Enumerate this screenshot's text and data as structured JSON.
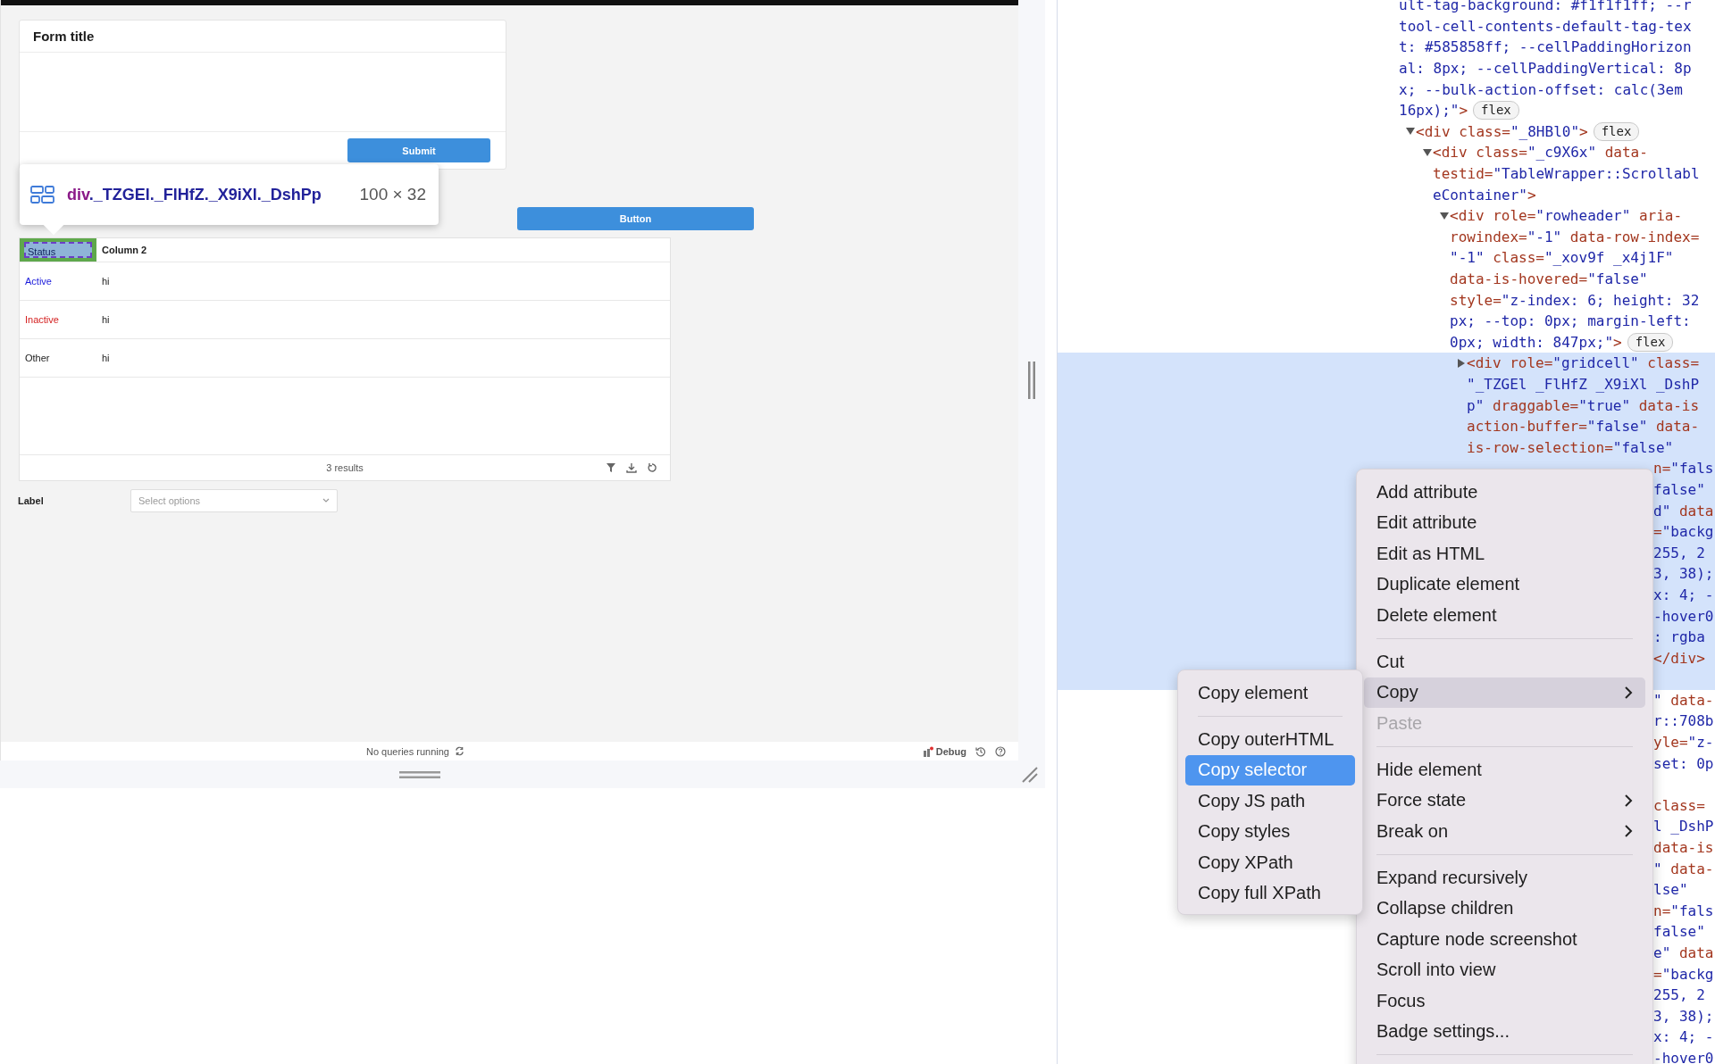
{
  "app": {
    "form": {
      "title": "Form title",
      "submit": "Submit"
    },
    "button": "Button",
    "table": {
      "columns": [
        {
          "label": "Status",
          "inspected": true
        },
        {
          "label": "Column 2",
          "inspected": false
        }
      ],
      "rows": [
        {
          "status": "Active",
          "color": "#1a1adb",
          "value": "hi"
        },
        {
          "status": "Inactive",
          "color": "#d42020",
          "value": "hi"
        },
        {
          "status": "Other",
          "value": "hi"
        }
      ],
      "footer": "3 results"
    },
    "field": {
      "label": "Label",
      "placeholder": "Select options"
    },
    "status_bar": {
      "message": "No queries running",
      "debug": "Debug"
    },
    "inspector_tooltip": {
      "tag": "div",
      "classes": "._TZGEl._FlHfZ._X9iXl._DshPp",
      "size": "100 × 32"
    }
  },
  "devtools": {
    "tree": {
      "continued": true,
      "selected": false,
      "badge": "flex",
      "lines": [
        "ult-tag-background: #f1f1f1ff; --r",
        "tool-cell-contents-default-tag-tex",
        "t: #585858ff; --cellPaddingHorizon",
        "al: 8px; --cellPaddingVertical: 8p",
        "x; --bulk-action-offset: calc(3em",
        "16px);\">"
      ],
      "children": [
        {
          "expanded": true,
          "selected": false,
          "badge": "flex",
          "lines": [
            "<div class=\"_8HBl0\">"
          ],
          "children": [
            {
              "expanded": true,
              "selected": false,
              "lines": [
                "<div class=\"_c9X6x\" data-",
                "testid=\"TableWrapper::Scrollabl",
                "eContainer\">"
              ],
              "children": [
                {
                  "expanded": true,
                  "selected": false,
                  "badge": "flex",
                  "lines": [
                    "<div role=\"rowheader\" aria-",
                    "rowindex=\"-1\" data-row-index=",
                    "\"-1\" class=\"_xov9f _x4j1F\"",
                    "data-is-hovered=\"false\"",
                    "style=\"z-index: 6; height: 32",
                    "px; --top: 0px; margin-left:",
                    "0px; width: 847px;\">"
                  ],
                  "children": [
                    {
                      "expanded": false,
                      "selected": true,
                      "lines": [
                        "<div role=\"gridcell\" class=",
                        "\"_TZGEl _FlHfZ _X9iXl _DshP",
                        "p\" draggable=\"true\" data-is",
                        "action-buffer=\"false\" data-",
                        "is-row-selection=\"false\""
                      ]
                    }
                  ]
                }
              ]
            }
          ]
        }
      ]
    },
    "fragments": [
      {
        "kind": "text",
        "text": "n=\"fals",
        "in_value": false,
        "selected": true
      },
      {
        "kind": "text",
        "text": "false\"",
        "in_value": true,
        "selected": true
      },
      {
        "kind": "text",
        "text": "d\" data",
        "in_value": true,
        "selected": true
      },
      {
        "kind": "text",
        "text": "=\"backg",
        "in_value": false,
        "selected": true
      },
      {
        "kind": "text",
        "text": "255, 2",
        "in_value": true,
        "selected": true
      },
      {
        "kind": "text",
        "text": "3, 38);",
        "in_value": true,
        "selected": true
      },
      {
        "kind": "text",
        "text": "x: 4; -",
        "in_value": true,
        "selected": true
      },
      {
        "kind": "text",
        "text": "-hover0",
        "in_value": true,
        "selected": true
      },
      {
        "kind": "text",
        "text": ": rgba",
        "in_value": true,
        "selected": true
      },
      {
        "kind": "text",
        "text": "</div>",
        "in_value": false,
        "selected": true
      },
      {
        "kind": "covered",
        "selected": true
      },
      {
        "kind": "text",
        "text": "\" data-",
        "in_value": true,
        "selected": false
      },
      {
        "kind": "text",
        "text": "r::708b",
        "in_value": true,
        "selected": false
      },
      {
        "kind": "text",
        "text": "yle=\"z-",
        "in_value": false,
        "selected": false
      },
      {
        "kind": "text",
        "text": "set: 0p",
        "in_value": true,
        "selected": false
      },
      {
        "kind": "covered",
        "selected": false
      },
      {
        "kind": "text",
        "text": "class=",
        "in_value": false,
        "selected": false
      },
      {
        "kind": "text",
        "text": "l _DshP",
        "in_value": true,
        "selected": false
      },
      {
        "kind": "text",
        "text": "data-is",
        "in_value": false,
        "selected": false
      },
      {
        "kind": "text",
        "text": "\" data-",
        "in_value": true,
        "selected": false
      },
      {
        "kind": "text",
        "text": "lse\"",
        "in_value": true,
        "selected": false
      },
      {
        "kind": "text",
        "text": "n=\"fals",
        "in_value": false,
        "selected": false
      },
      {
        "kind": "text",
        "text": "false\"",
        "in_value": true,
        "selected": false
      },
      {
        "kind": "text",
        "text": "e\" data",
        "in_value": true,
        "selected": false
      },
      {
        "kind": "text",
        "text": "=\"backg",
        "in_value": false,
        "selected": false
      },
      {
        "kind": "text",
        "text": "255, 2",
        "in_value": true,
        "selected": false
      },
      {
        "kind": "text",
        "text": "3, 38);",
        "in_value": true,
        "selected": false
      },
      {
        "kind": "text",
        "text": "x: 4; -",
        "in_value": true,
        "selected": false
      },
      {
        "kind": "text",
        "text": "-hover0",
        "in_value": true,
        "selected": false
      }
    ],
    "context_menu": {
      "items": [
        {
          "kind": "item",
          "label": "Add attribute",
          "disabled": false,
          "selected": false,
          "submenu": false
        },
        {
          "kind": "item",
          "label": "Edit attribute",
          "disabled": false,
          "selected": false,
          "submenu": false
        },
        {
          "kind": "item",
          "label": "Edit as HTML",
          "disabled": false,
          "selected": false,
          "submenu": false
        },
        {
          "kind": "item",
          "label": "Duplicate element",
          "disabled": false,
          "selected": false,
          "submenu": false
        },
        {
          "kind": "item",
          "label": "Delete element",
          "disabled": false,
          "selected": false,
          "submenu": false
        },
        {
          "kind": "separator"
        },
        {
          "kind": "item",
          "label": "Cut",
          "disabled": false,
          "selected": false,
          "submenu": false
        },
        {
          "kind": "item",
          "label": "Copy",
          "disabled": false,
          "selected": true,
          "submenu": true
        },
        {
          "kind": "item",
          "label": "Paste",
          "disabled": true,
          "selected": false,
          "submenu": false
        },
        {
          "kind": "separator"
        },
        {
          "kind": "item",
          "label": "Hide element",
          "disabled": false,
          "selected": false,
          "submenu": false
        },
        {
          "kind": "item",
          "label": "Force state",
          "disabled": false,
          "selected": false,
          "submenu": true
        },
        {
          "kind": "item",
          "label": "Break on",
          "disabled": false,
          "selected": false,
          "submenu": true
        },
        {
          "kind": "separator"
        },
        {
          "kind": "item",
          "label": "Expand recursively",
          "disabled": false,
          "selected": false,
          "submenu": false
        },
        {
          "kind": "item",
          "label": "Collapse children",
          "disabled": false,
          "selected": false,
          "submenu": false
        },
        {
          "kind": "item",
          "label": "Capture node screenshot",
          "disabled": false,
          "selected": false,
          "submenu": false
        },
        {
          "kind": "item",
          "label": "Scroll into view",
          "disabled": false,
          "selected": false,
          "submenu": false
        },
        {
          "kind": "item",
          "label": "Focus",
          "disabled": false,
          "selected": false,
          "submenu": false
        },
        {
          "kind": "item",
          "label": "Badge settings...",
          "disabled": false,
          "selected": false,
          "submenu": false
        },
        {
          "kind": "separator"
        }
      ]
    },
    "submenu": {
      "items": [
        {
          "kind": "item",
          "label": "Copy element",
          "disabled": false,
          "selected": false,
          "submenu": false
        },
        {
          "kind": "separator"
        },
        {
          "kind": "item",
          "label": "Copy outerHTML",
          "disabled": false,
          "selected": false,
          "submenu": false
        },
        {
          "kind": "item",
          "label": "Copy selector",
          "disabled": false,
          "selected": true,
          "submenu": false
        },
        {
          "kind": "item",
          "label": "Copy JS path",
          "disabled": false,
          "selected": false,
          "submenu": false
        },
        {
          "kind": "item",
          "label": "Copy styles",
          "disabled": false,
          "selected": false,
          "submenu": false
        },
        {
          "kind": "item",
          "label": "Copy XPath",
          "disabled": false,
          "selected": false,
          "submenu": false
        },
        {
          "kind": "item",
          "label": "Copy full XPath",
          "disabled": false,
          "selected": false,
          "submenu": false
        }
      ]
    }
  }
}
